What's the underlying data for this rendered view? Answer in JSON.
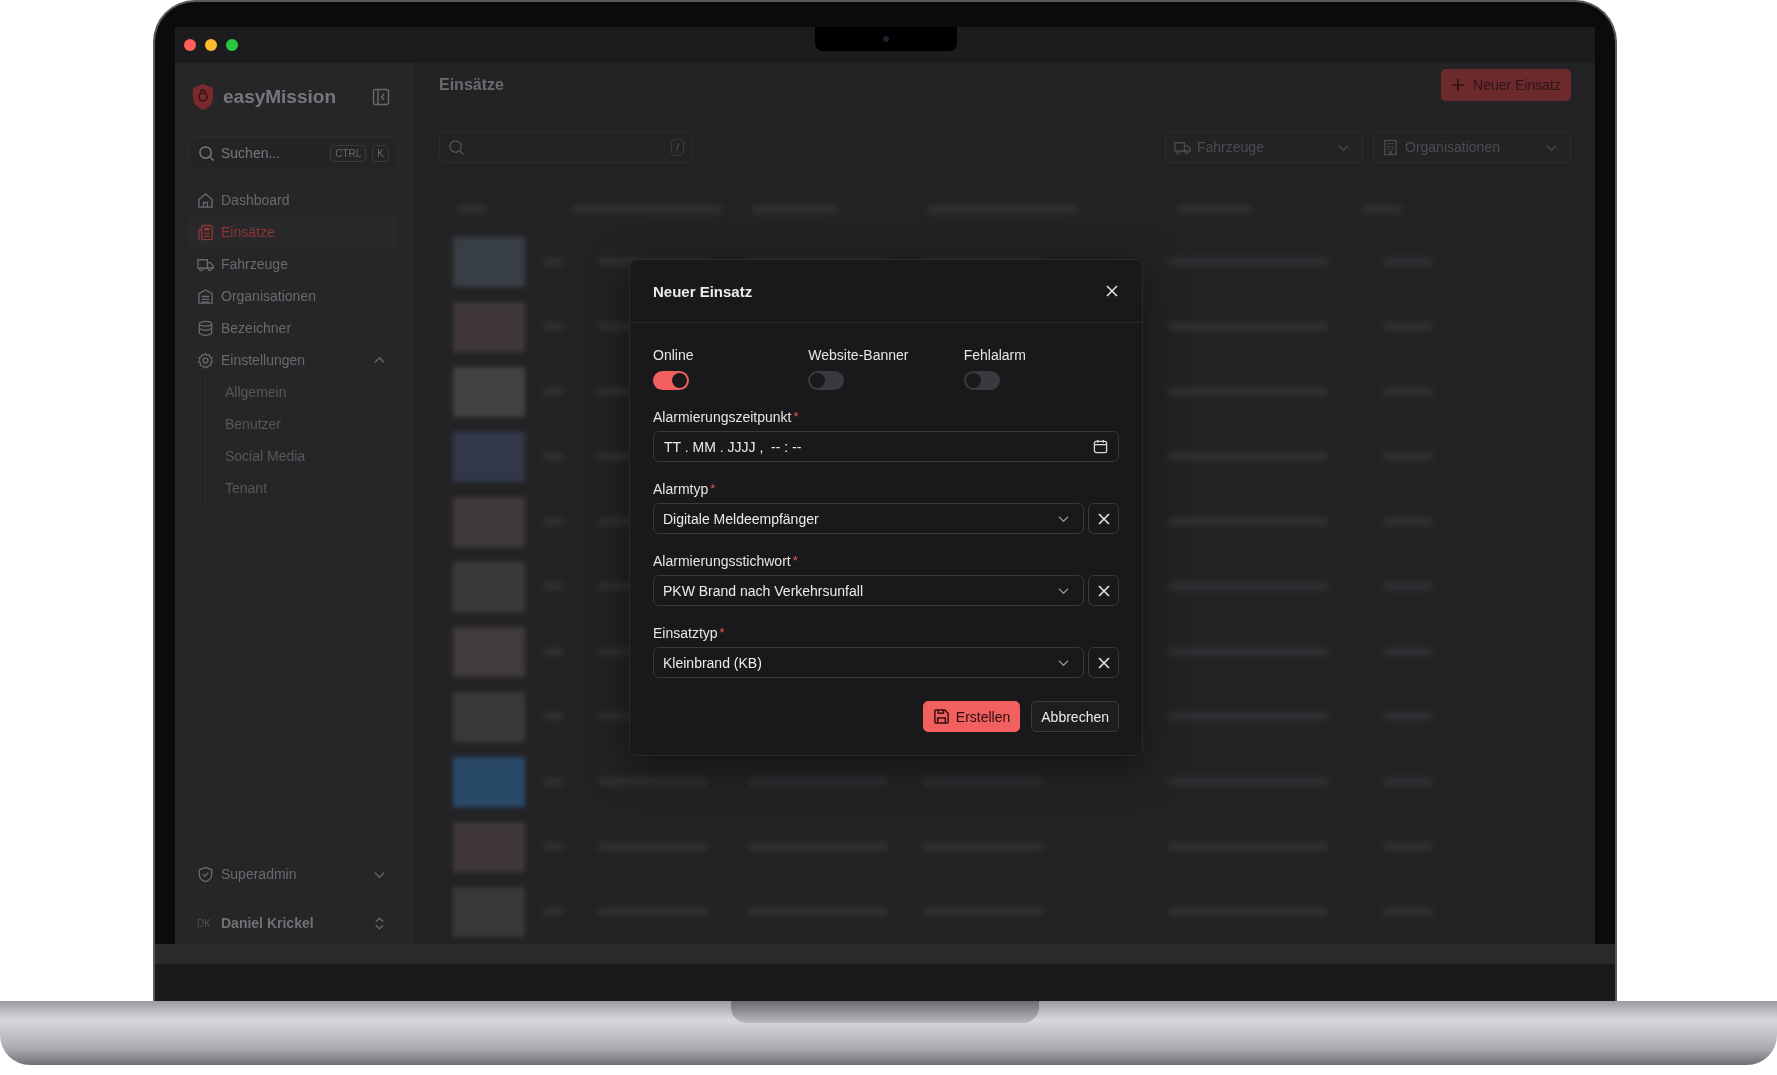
{
  "app": {
    "name": "easyMission"
  },
  "sidebar": {
    "search": {
      "placeholder": "Suchen...",
      "shortcut": [
        "CTRL",
        "K"
      ]
    },
    "items": [
      {
        "label": "Dashboard",
        "kind": "home",
        "selected": false
      },
      {
        "label": "Einsätze",
        "kind": "report",
        "selected": true
      },
      {
        "label": "Fahrzeuge",
        "kind": "vehicles",
        "selected": false
      },
      {
        "label": "Organisationen",
        "kind": "organizations",
        "selected": false
      },
      {
        "label": "Bezeichner",
        "kind": "identifiers",
        "selected": false
      },
      {
        "label": "Einstellungen",
        "kind": "settings",
        "selected": false,
        "expanded": true,
        "children": [
          {
            "label": "Allgemein",
            "selected": false
          },
          {
            "label": "Benutzer",
            "selected": false
          },
          {
            "label": "Social Media",
            "selected": false
          },
          {
            "label": "Tenant",
            "selected": false
          }
        ]
      }
    ],
    "footer": {
      "role": {
        "label": "Superadmin",
        "expanded": false
      },
      "user": {
        "initials": "DK",
        "name": "Daniel Krickel"
      }
    }
  },
  "header": {
    "title": "Einsätze",
    "action": "Neuer Einsatz"
  },
  "filters": {
    "search_shortcut": "/",
    "dropdowns": [
      {
        "label": "Fahrzeuge",
        "kind": "vehicles"
      },
      {
        "label": "Organisationen",
        "kind": "organizations"
      }
    ]
  },
  "dialog": {
    "title": "Neuer Einsatz",
    "toggles": [
      {
        "label": "Online",
        "on": true
      },
      {
        "label": "Website-Banner",
        "on": false
      },
      {
        "label": "Fehlalarm",
        "on": false
      }
    ],
    "fields": [
      {
        "label": "Alarmierungszeitpunkt",
        "required_mark": "*",
        "kind": "datetime",
        "placeholder": "TT . MM . JJJJ ,  -- : --"
      },
      {
        "label": "Alarmtyp",
        "required_mark": "*",
        "kind": "select",
        "value": "Digitale Meldeempfänger"
      },
      {
        "label": "Alarmierungsstichwort",
        "required_mark": "*",
        "kind": "select",
        "value": "PKW Brand nach Verkehrsunfall"
      },
      {
        "label": "Einsatztyp",
        "required_mark": "*",
        "kind": "select",
        "value": "Kleinbrand (KB)"
      }
    ],
    "buttons": [
      {
        "label": "Erstellen",
        "kind": "primary"
      },
      {
        "label": "Abbrechen",
        "kind": "secondary"
      }
    ]
  }
}
